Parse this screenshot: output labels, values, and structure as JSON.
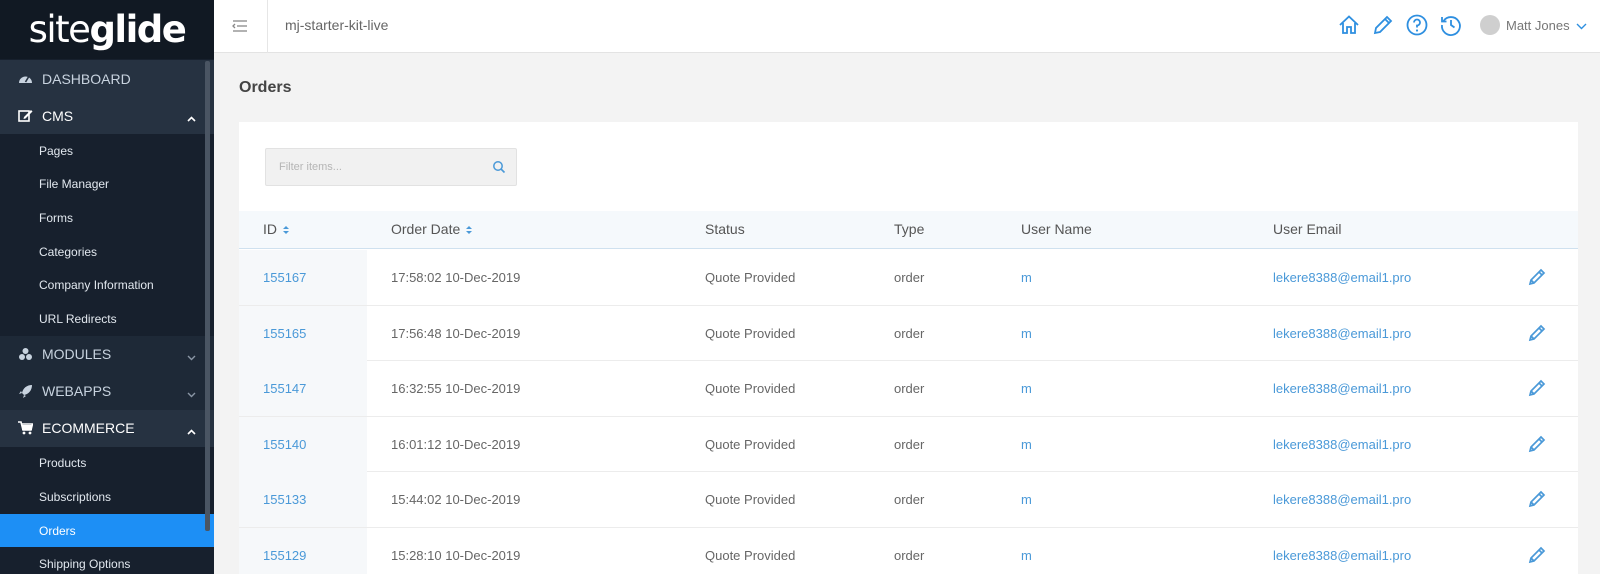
{
  "brand": {
    "logo_light": "site",
    "logo_bold": "glide"
  },
  "sidebar": {
    "dashboard": "DASHBOARD",
    "cms": "CMS",
    "cms_items": [
      "Pages",
      "File Manager",
      "Forms",
      "Categories",
      "Company Information",
      "URL Redirects"
    ],
    "modules": "MODULES",
    "webapps": "WEBAPPS",
    "ecommerce": "ECOMMERCE",
    "ecommerce_items": [
      "Products",
      "Subscriptions",
      "Orders",
      "Shipping Options"
    ],
    "active_item": "Orders"
  },
  "topbar": {
    "site_name": "mj-starter-kit-live",
    "user_name": "Matt Jones",
    "icons": [
      "home-icon",
      "pencil-icon",
      "help-icon",
      "history-icon"
    ]
  },
  "page": {
    "title": "Orders"
  },
  "filter": {
    "placeholder": "Filter items..."
  },
  "table": {
    "headers": [
      "ID",
      "Order Date",
      "Status",
      "Type",
      "User Name",
      "User Email"
    ],
    "rows": [
      {
        "id": "155167",
        "date": "17:58:02 10-Dec-2019",
        "status": "Quote Provided",
        "type": "order",
        "user": "m",
        "email": "lekere8388@email1.pro"
      },
      {
        "id": "155165",
        "date": "17:56:48 10-Dec-2019",
        "status": "Quote Provided",
        "type": "order",
        "user": "m",
        "email": "lekere8388@email1.pro"
      },
      {
        "id": "155147",
        "date": "16:32:55 10-Dec-2019",
        "status": "Quote Provided",
        "type": "order",
        "user": "m",
        "email": "lekere8388@email1.pro"
      },
      {
        "id": "155140",
        "date": "16:01:12 10-Dec-2019",
        "status": "Quote Provided",
        "type": "order",
        "user": "m",
        "email": "lekere8388@email1.pro"
      },
      {
        "id": "155133",
        "date": "15:44:02 10-Dec-2019",
        "status": "Quote Provided",
        "type": "order",
        "user": "m",
        "email": "lekere8388@email1.pro"
      },
      {
        "id": "155129",
        "date": "15:28:10 10-Dec-2019",
        "status": "Quote Provided",
        "type": "order",
        "user": "m",
        "email": "lekere8388@email1.pro"
      }
    ]
  },
  "colors": {
    "accent": "#1d8ff5",
    "link": "#4a99d8",
    "sidebar_bg": "#17202d"
  }
}
